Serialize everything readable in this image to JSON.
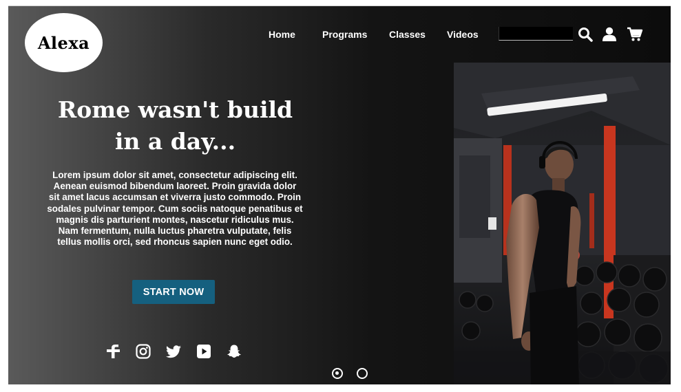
{
  "brand": {
    "logo_text": "Alexa"
  },
  "nav": {
    "items": [
      "Home",
      "Programs",
      "Classes",
      "Videos"
    ]
  },
  "search": {
    "placeholder": "",
    "value": ""
  },
  "header_icons": [
    "search-icon",
    "user-icon",
    "cart-icon"
  ],
  "hero": {
    "headline_line1": "Rome wasn't build",
    "headline_line2": "in a day...",
    "body": "Lorem ipsum dolor sit amet, consectetur adipiscing elit. Aenean euismod bibendum laoreet. Proin gravida dolor sit amet lacus accumsan et viverra justo commodo. Proin sodales pulvinar tempor. Cum sociis natoque penatibus et magnis dis parturient montes, nascetur ridiculus mus. Nam fermentum, nulla luctus pharetra vulputate, felis tellus mollis orci, sed rhoncus sapien nunc eget odio.",
    "cta_label": "START NOW"
  },
  "social_icons": [
    "facebook-icon",
    "instagram-icon",
    "twitter-icon",
    "youtube-icon",
    "snapchat-icon"
  ],
  "carousel": {
    "slides": 2,
    "active_index": 0
  },
  "colors": {
    "cta": "#15607f",
    "accent_red": "#c8361f"
  }
}
